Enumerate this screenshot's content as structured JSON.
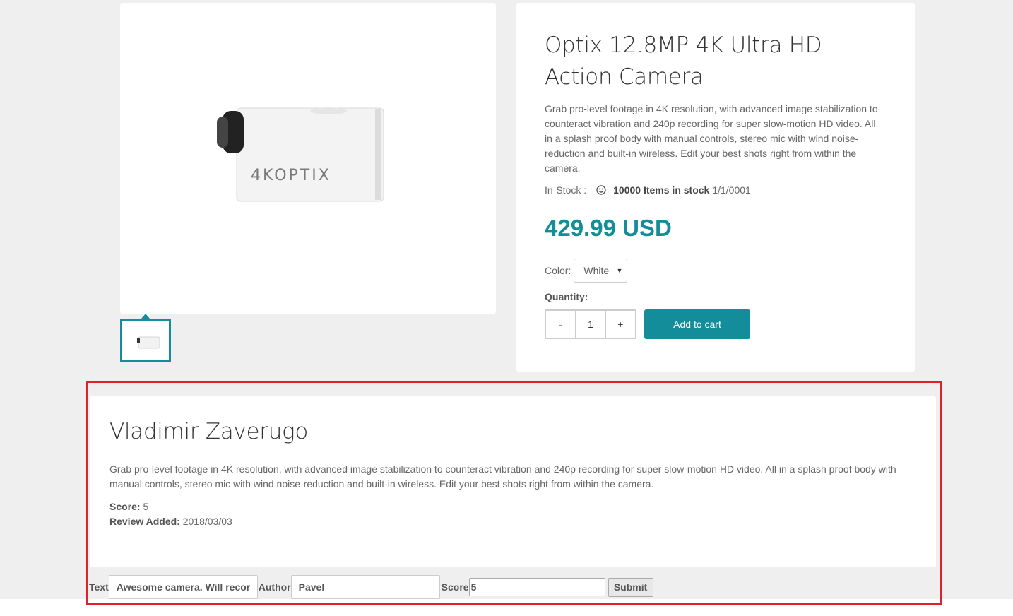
{
  "product": {
    "title": "Optix 12.8MP 4K Ultra HD Action Camera",
    "description": "Grab pro-level footage in 4K resolution, with advanced image stabilization to counteract vibration and 240p recording for super slow-motion HD video. All in a splash proof body with manual controls, stereo mic with wind noise-reduction and built-in wireless. Edit your best shots right from within the camera.",
    "stock_label": "In-Stock :",
    "stock_count": "10000 Items in stock",
    "stock_date": "1/1/0001",
    "price": "429.99 USD",
    "color_label": "Color:",
    "color_value": "White",
    "quantity_label": "Quantity:",
    "quantity_minus": "-",
    "quantity_value": "1",
    "quantity_plus": "+",
    "add_to_cart": "Add to cart",
    "camera_brand": "4KOPTIX"
  },
  "review": {
    "author": "Vladimir Zaverugo",
    "text": "Grab pro-level footage in 4K resolution, with advanced image stabilization to counteract vibration and 240p recording for super slow-motion HD video. All in a splash proof body with manual controls, stereo mic with wind noise-reduction and built-in wireless. Edit your best shots right from within the camera.",
    "score_label": "Score:",
    "score_value": "5",
    "added_label": "Review Added:",
    "added_value": "2018/03/03"
  },
  "review_form": {
    "text_label": "Text",
    "text_value": "Awesome camera. Will recor",
    "author_label": "Author",
    "author_value": "Pavel",
    "score_label": "Score",
    "score_value": "5",
    "submit_label": "Submit"
  },
  "colors": {
    "accent": "#138d99",
    "highlight_border": "#e0202a"
  }
}
